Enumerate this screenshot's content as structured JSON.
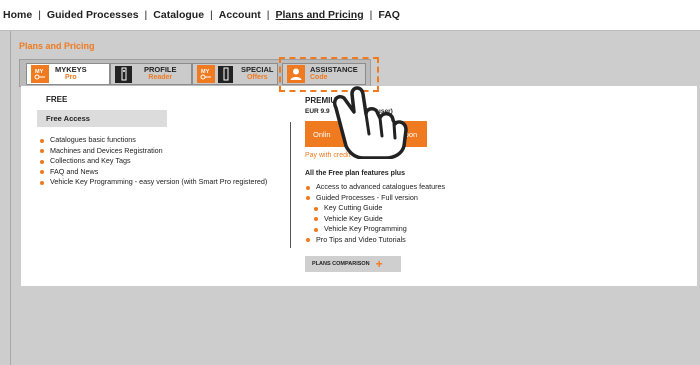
{
  "nav": {
    "items": [
      "Home",
      "Guided Processes",
      "Catalogue",
      "Account",
      "Plans and Pricing",
      "FAQ"
    ],
    "separator": "|",
    "active": "Plans and Pricing"
  },
  "page_title": "Plans and Pricing",
  "tabs": [
    {
      "icon_text": "MY",
      "label": "MYKEYS",
      "sub": "Pro",
      "icon": "mykeys-icon"
    },
    {
      "label": "PROFILE",
      "sub": "Reader",
      "icon": "key-reader-icon"
    },
    {
      "icon_text": "MY",
      "label": "SPECIAL",
      "sub": "Offers",
      "icon": "special-offers-icon"
    },
    {
      "label": "ASSISTANCE",
      "sub": "Code",
      "icon": "user-icon"
    }
  ],
  "free": {
    "heading": "FREE",
    "access_label": "Free Access",
    "features": [
      "Catalogues basic functions",
      "Machines and Devices Registration",
      "Collections and Key Tags",
      "FAQ and News",
      "Vehicle Key Programming - easy version (with Smart Pro registered)"
    ]
  },
  "premium": {
    "heading": "PREMIUM",
    "price": "EUR 9.9          nthly per user)",
    "online_label_left": "Onlin",
    "online_label_right": "no Coupon",
    "pay_credit": "Pay with credit card",
    "all_free": "All the Free plan features plus",
    "features": [
      {
        "text": "Access to advanced catalogues features",
        "sub": false
      },
      {
        "text": "Guided Processes - Full version",
        "sub": false
      },
      {
        "text": "Key Cutting Guide",
        "sub": true
      },
      {
        "text": "Vehicle Key Guide",
        "sub": true
      },
      {
        "text": "Vehicle Key Programming",
        "sub": true
      },
      {
        "text": "Pro Tips and Video Tutorials",
        "sub": false
      }
    ],
    "comparison_label": "PLANS COMPARISON",
    "plus": "+"
  },
  "colors": {
    "accent": "#ef7a20",
    "background": "#cdcdcd",
    "panel": "#ffffff"
  }
}
